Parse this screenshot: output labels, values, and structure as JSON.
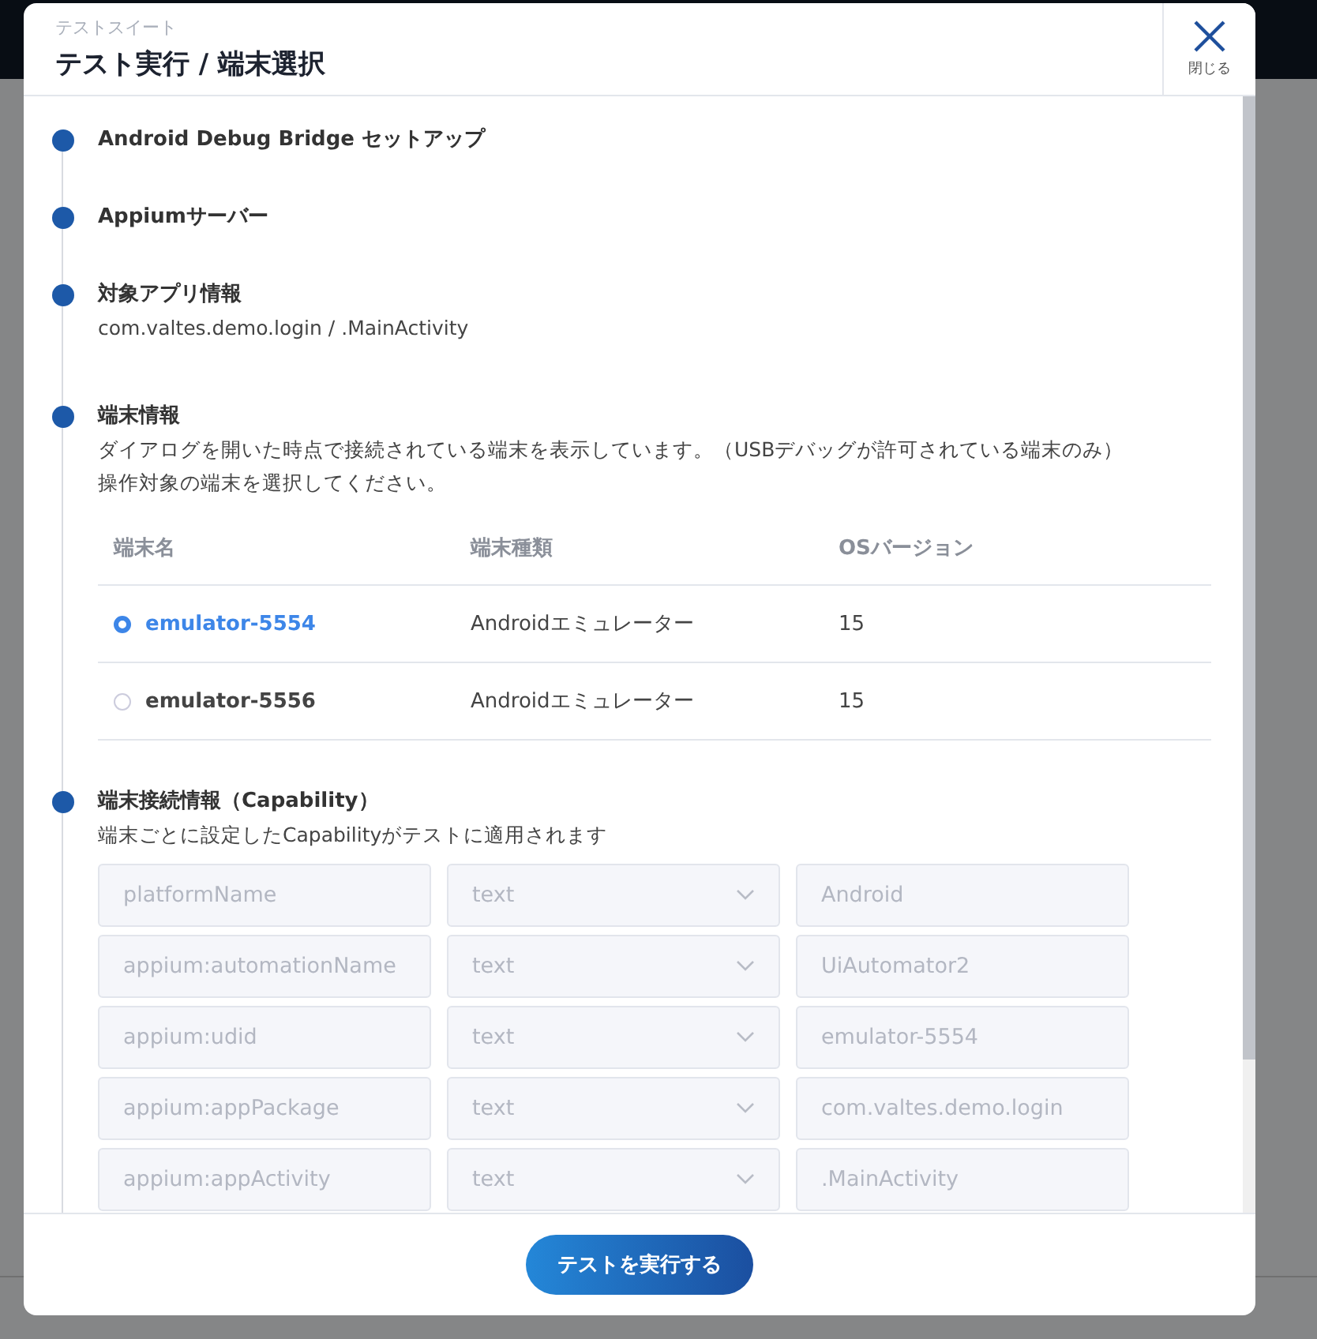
{
  "dialog": {
    "subtitle": "テストスイート",
    "title": "テスト実行 / 端末選択",
    "close_label": "閉じる"
  },
  "steps": [
    {
      "kind": "plain",
      "title": "Android Debug Bridge セットアップ"
    },
    {
      "kind": "plain",
      "title": "Appiumサーバー"
    },
    {
      "kind": "app",
      "title": "対象アプリ情報",
      "detail": "com.valtes.demo.login / .MainActivity"
    },
    {
      "kind": "devices",
      "title": "端末情報",
      "description": [
        "ダイアログを開いた時点で接続されている端末を表示しています。（USBデバッグが許可されている端末のみ）",
        "操作対象の端末を選択してください。"
      ],
      "table": {
        "columns": [
          "端末名",
          "端末種類",
          "OSバージョン"
        ],
        "rows": [
          {
            "name": "emulator-5554",
            "type": "Androidエミュレーター",
            "os": "15",
            "selected": true
          },
          {
            "name": "emulator-5556",
            "type": "Androidエミュレーター",
            "os": "15",
            "selected": false
          }
        ]
      }
    },
    {
      "kind": "capabilities",
      "title": "端末接続情報（Capability）",
      "detail": "端末ごとに設定したCapabilityがテストに適用されます",
      "capabilities": [
        {
          "name": "platformName",
          "type": "text",
          "value": "Android",
          "disabled": true
        },
        {
          "name": "appium:automationName",
          "type": "text",
          "value": "UiAutomator2",
          "disabled": true
        },
        {
          "name": "appium:udid",
          "type": "text",
          "value": "emulator-5554",
          "disabled": true
        },
        {
          "name": "appium:appPackage",
          "type": "text",
          "value": "com.valtes.demo.login",
          "disabled": true
        },
        {
          "name": "appium:appActivity",
          "type": "text",
          "value": ".MainActivity",
          "disabled": true
        }
      ]
    }
  ],
  "run_button": "テストを実行する"
}
